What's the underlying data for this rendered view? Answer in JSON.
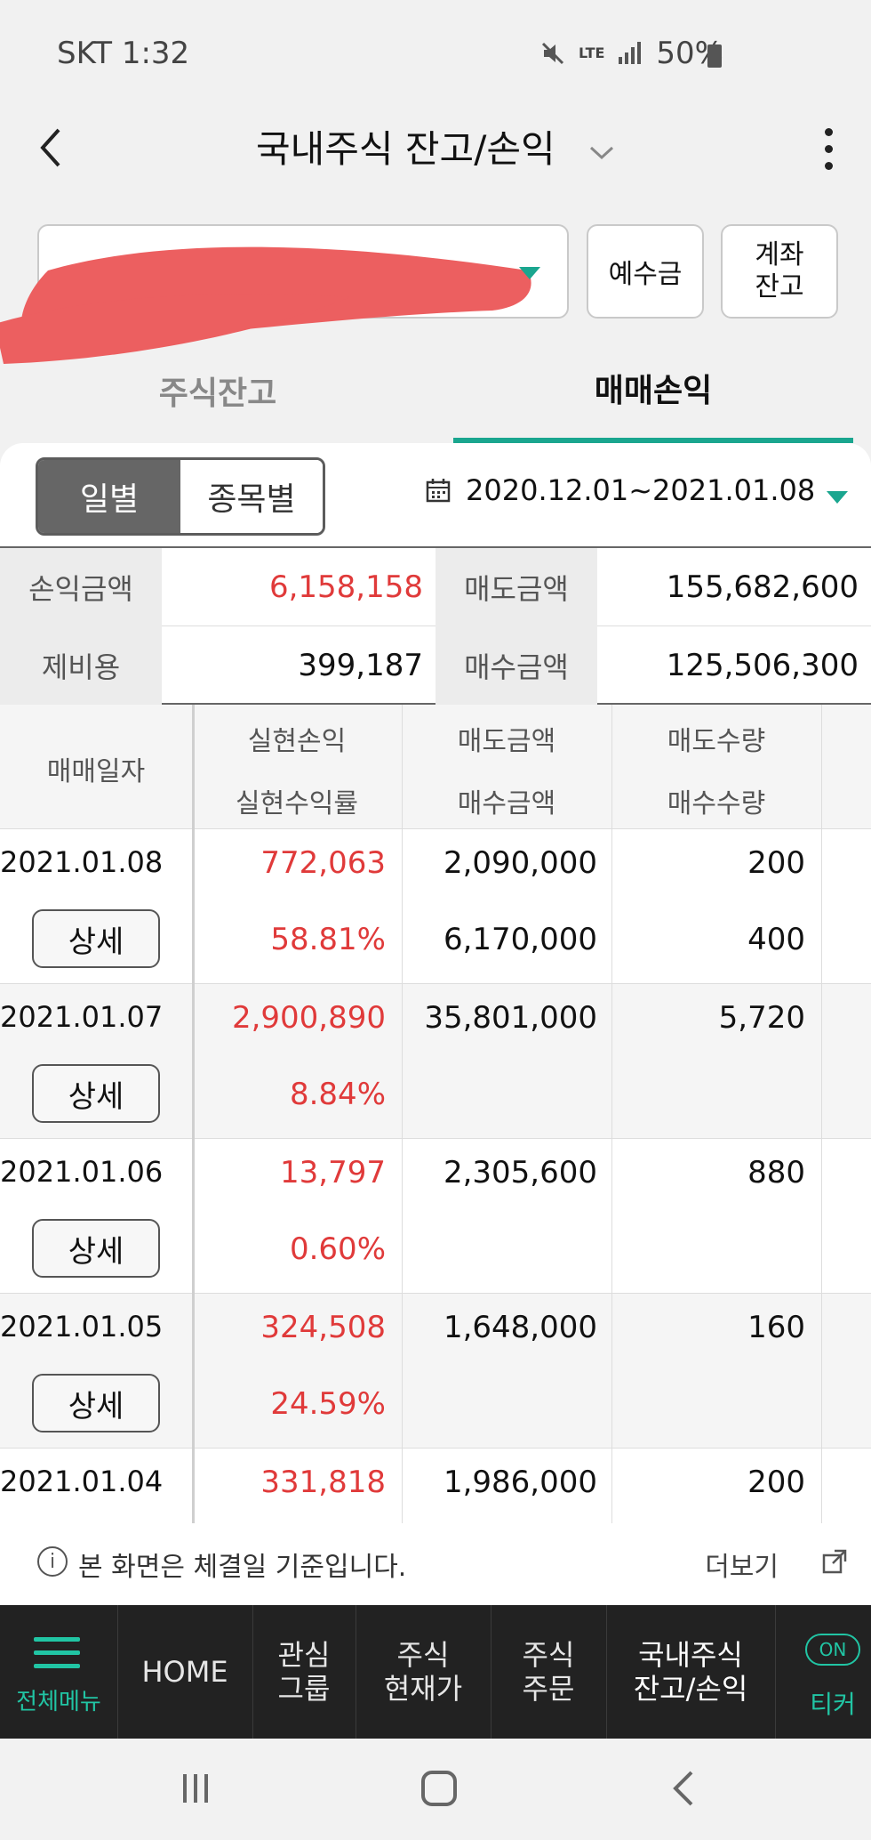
{
  "status_bar": {
    "carrier_time": "SKT 1:32",
    "battery": "50%",
    "network": "LTE"
  },
  "header": {
    "title": "국내주식 잔고/손익"
  },
  "account": {
    "deposit_button": "예수금",
    "balance_button": "계좌\n잔고"
  },
  "tabs": [
    {
      "label": "주식잔고",
      "active": false
    },
    {
      "label": "매매손익",
      "active": true
    }
  ],
  "filter": {
    "daily": "일별",
    "by_stock": "종목별",
    "date_range": "2020.12.01~2021.01.08"
  },
  "summary": {
    "pnl_label": "손익금액",
    "pnl_value": "6,158,158",
    "sell_label": "매도금액",
    "sell_value": "155,682,600",
    "fee_label": "제비용",
    "fee_value": "399,187",
    "buy_label": "매수금액",
    "buy_value": "125,506,300"
  },
  "table": {
    "headers": {
      "date": "매매일자",
      "realized_pnl": "실현손익",
      "realized_rate": "실현수익률",
      "sell_amount": "매도금액",
      "buy_amount": "매수금액",
      "sell_qty": "매도수량",
      "buy_qty": "매수수량"
    },
    "detail_label": "상세",
    "rows": [
      {
        "date": "2021.01.08",
        "pnl": "772,063",
        "rate": "58.81%",
        "sell_amt": "2,090,000",
        "buy_amt": "6,170,000",
        "sell_qty": "200",
        "buy_qty": "400"
      },
      {
        "date": "2021.01.07",
        "pnl": "2,900,890",
        "rate": "8.84%",
        "sell_amt": "35,801,000",
        "buy_amt": "",
        "sell_qty": "5,720",
        "buy_qty": ""
      },
      {
        "date": "2021.01.06",
        "pnl": "13,797",
        "rate": "0.60%",
        "sell_amt": "2,305,600",
        "buy_amt": "",
        "sell_qty": "880",
        "buy_qty": ""
      },
      {
        "date": "2021.01.05",
        "pnl": "324,508",
        "rate": "24.59%",
        "sell_amt": "1,648,000",
        "buy_amt": "",
        "sell_qty": "160",
        "buy_qty": ""
      },
      {
        "date": "2021.01.04",
        "pnl": "331,818",
        "rate": "",
        "sell_amt": "1,986,000",
        "buy_amt": "",
        "sell_qty": "200",
        "buy_qty": ""
      }
    ]
  },
  "notice": {
    "text": "본 화면은 체결일 기준입니다.",
    "more": "더보기"
  },
  "bottom_nav": {
    "menu": "전체메뉴",
    "home": "HOME",
    "watch": "관심\n그룹",
    "price": "주식\n현재가",
    "order": "주식\n주문",
    "current": "국내주식\n잔고/손익",
    "ticker_badge": "ON",
    "ticker": "티커"
  },
  "colors": {
    "accent": "#1aa68f",
    "profit": "#e03a3a",
    "nav_bg": "#222222"
  }
}
